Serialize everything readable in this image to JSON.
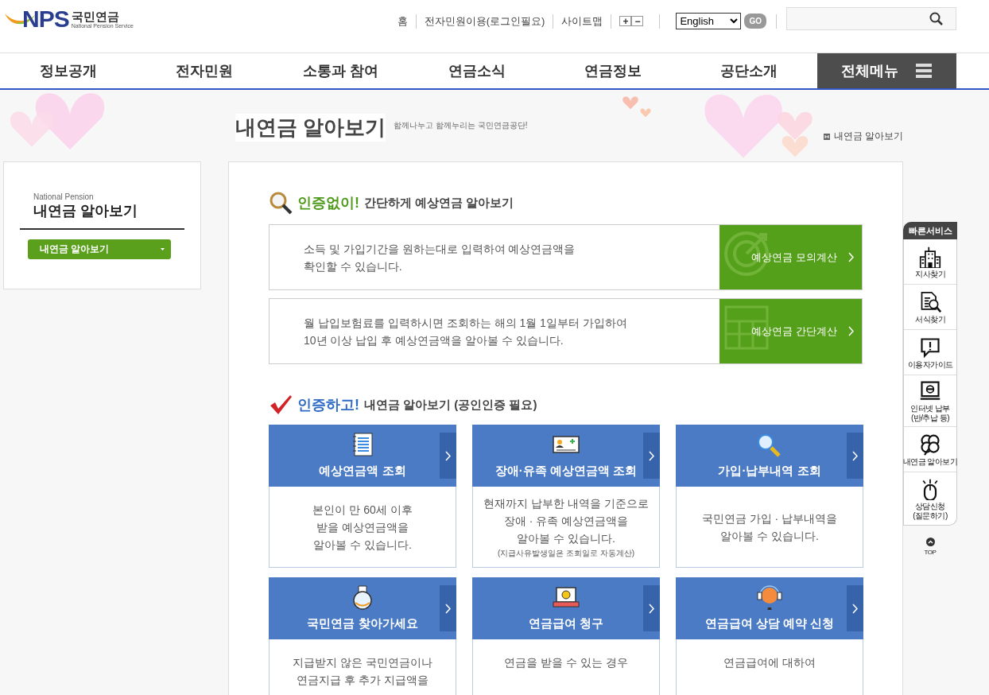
{
  "header": {
    "logo_mark": "NPS",
    "logo_name": "국민연금",
    "logo_sub": "National Pension Service",
    "util_links": [
      "홈",
      "전자민원이용(로그인필요)",
      "사이트맵"
    ],
    "zoom_in": "+",
    "zoom_out": "−",
    "language": "English",
    "go": "GO"
  },
  "nav": {
    "items": [
      {
        "label": "정보공개",
        "selected": false
      },
      {
        "label": "전자민원",
        "selected": false
      },
      {
        "label": "소통과 참여",
        "selected": false
      },
      {
        "label": "연금소식",
        "selected": false
      },
      {
        "label": "연금정보",
        "selected": false
      },
      {
        "label": "공단소개",
        "selected": false
      }
    ],
    "all_menu": "전체메뉴"
  },
  "page": {
    "title": "내연금 알아보기",
    "slogan": "함께나누고 함께누리는 국민연금공단!",
    "breadcrumb": "내연금 알아보기"
  },
  "sidebar": {
    "eyebrow": "National Pension",
    "title": "내연금 알아보기",
    "items": [
      {
        "label": "내연금 알아보기",
        "selected": true
      }
    ]
  },
  "sections": [
    {
      "kind": "rows",
      "emphasis": "인증없이!",
      "heading": "간단하게 예상연금 알아보기",
      "rows": [
        {
          "lines": [
            "소득 및 가입기간을 원하는대로 입력하여 예상연금액을",
            "확인할 수 있습니다."
          ],
          "button": "예상연금 모의계산"
        },
        {
          "lines": [
            "월 납입보험료를 입력하시면 조회하는 해의 1월 1일부터 가입하여",
            "10년 이상 납입 후 예상연금액을 알아볼 수 있습니다."
          ],
          "button": "예상연금 간단계산"
        }
      ]
    },
    {
      "kind": "cards",
      "emphasis": "인증하고!",
      "heading": "내연금 알아보기 (공인인증 필요)",
      "cards": [
        {
          "title": "예상연금액 조회",
          "lines": [
            "본인이 만 60세 이후",
            "받을 예상연금액을",
            "알아볼 수 있습니다."
          ]
        },
        {
          "title": "장애·유족 예상연금액 조회",
          "lines": [
            "현재까지 납부한 내역을 기준으로",
            "장애  · 유족 예상연금액을",
            "알아볼 수 있습니다."
          ],
          "note": "(지급사유발생일은 조회일로 자동계산)"
        },
        {
          "title": "가입·납부내역 조회",
          "lines": [
            "국민연금 가입  · 납부내역을",
            "알아볼 수 있습니다."
          ]
        },
        {
          "title": "국민연금 찾아가세요",
          "lines": [
            "지급받지 않은 국민연금이나",
            "연금지급 후 추가 지급액을"
          ]
        },
        {
          "title": "연금급여 청구",
          "lines": [
            "연금을 받을 수 있는 경우"
          ]
        },
        {
          "title": "연금급여 상담 예약 신청",
          "lines": [
            "연금급여에 대하여"
          ]
        }
      ]
    }
  ],
  "quick": {
    "title": "빠른서비스",
    "items": [
      {
        "lines": [
          "지사찾기"
        ]
      },
      {
        "lines": [
          "서식찾기"
        ]
      },
      {
        "lines": [
          "이용자가이드"
        ]
      },
      {
        "lines": [
          "인터넷 납부",
          "(반/추납 등)"
        ]
      },
      {
        "lines": [
          "내연금 알아보기"
        ]
      },
      {
        "lines": [
          "상담신청",
          "(질문하기)"
        ]
      }
    ],
    "top": "TOP"
  }
}
